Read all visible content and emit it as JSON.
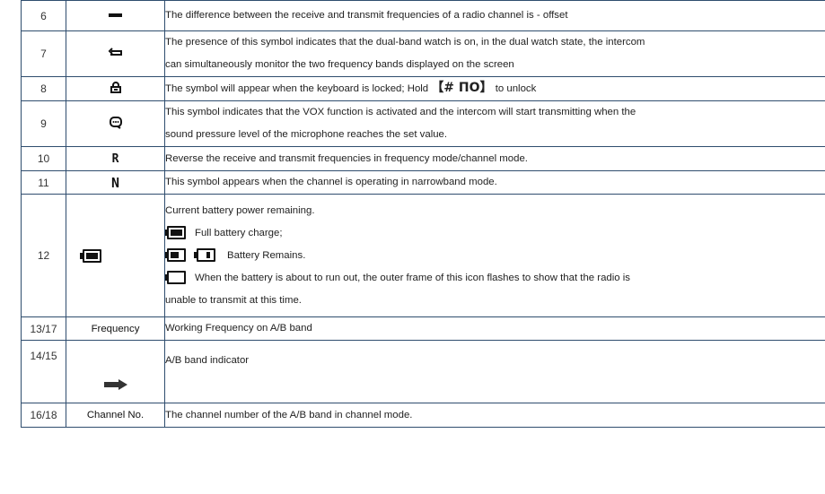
{
  "rows": [
    {
      "no": "6",
      "symbol_icon": "minus-sign-icon",
      "desc": [
        "The difference between the receive and transmit frequencies of a radio channel is - offset"
      ]
    },
    {
      "no": "7",
      "symbol_icon": "dual-watch-loop-icon",
      "symbol_glyph": "⥃",
      "desc": [
        "The presence of this symbol indicates that the dual-band watch is on, in the dual watch state, the intercom",
        "can simultaneously monitor the two frequency bands displayed on the screen"
      ]
    },
    {
      "no": "8",
      "symbol_icon": "keyboard-lock-icon",
      "symbol_glyph": "ꬻ",
      "desc_prefix": "The symbol will appear when the keyboard is locked;  Hold ",
      "desc_key": "【# ΠΟ】",
      "desc_suffix": " to unlock"
    },
    {
      "no": "9",
      "symbol_icon": "vox-icon",
      "symbol_glyph": "⊙",
      "desc": [
        "This symbol indicates that the VOX function is activated and the intercom will start transmitting when the",
        "sound pressure level of the microphone reaches the set value."
      ]
    },
    {
      "no": "10",
      "symbol": "R",
      "symbol_icon": "reverse-r-icon",
      "desc": [
        "Reverse the receive and transmit frequencies in frequency mode/channel mode."
      ]
    },
    {
      "no": "11",
      "symbol": "N",
      "symbol_icon": "narrowband-n-icon",
      "desc": [
        "This symbol appears when the channel is operating in narrowband mode."
      ]
    },
    {
      "no": "12",
      "symbol_icon": "battery-full-icon",
      "battery": {
        "title": "Current battery power remaining.",
        "full": "Full battery charge;",
        "remains": "Battery Remains.",
        "empty_1": "When the battery is about to run out, the outer frame of this icon flashes to show that the radio is",
        "empty_2": "unable to transmit at this time."
      }
    },
    {
      "no": "13/17",
      "symbol": "Frequency",
      "desc": [
        "Working Frequency on A/B band"
      ]
    },
    {
      "no": "14/15",
      "symbol_icon": "right-arrow-icon",
      "desc": [
        "A/B band indicator"
      ]
    },
    {
      "no": "16/18",
      "symbol": "Channel No.",
      "desc": [
        "The channel number of the A/B band in channel mode."
      ]
    }
  ]
}
